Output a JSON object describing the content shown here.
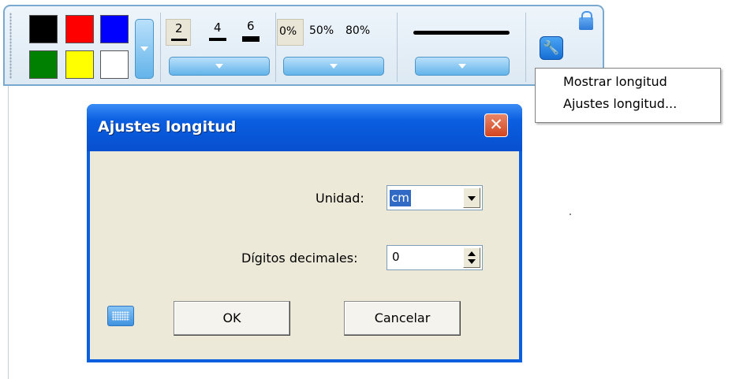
{
  "toolbar": {
    "colors": [
      "#000000",
      "#ff0000",
      "#0000ff",
      "#008000",
      "#ffff00",
      "#ffffff"
    ],
    "line_widths": [
      "2",
      "4",
      "6"
    ],
    "opacity_options": [
      "0%",
      "50%",
      "80%"
    ],
    "tool_icon": "wrench-icon",
    "lock_icon": "lock-icon"
  },
  "context_menu": {
    "items": [
      "Mostrar longitud",
      "Ajustes longitud..."
    ]
  },
  "dialog": {
    "title": "Ajustes longitud",
    "close_icon": "close-icon",
    "unit_label": "Unidad:",
    "unit_value": "cm",
    "decimals_label": "Dígitos decimales:",
    "decimals_value": "0",
    "keyboard_icon": "keyboard-icon",
    "ok_label": "OK",
    "cancel_label": "Cancelar"
  }
}
